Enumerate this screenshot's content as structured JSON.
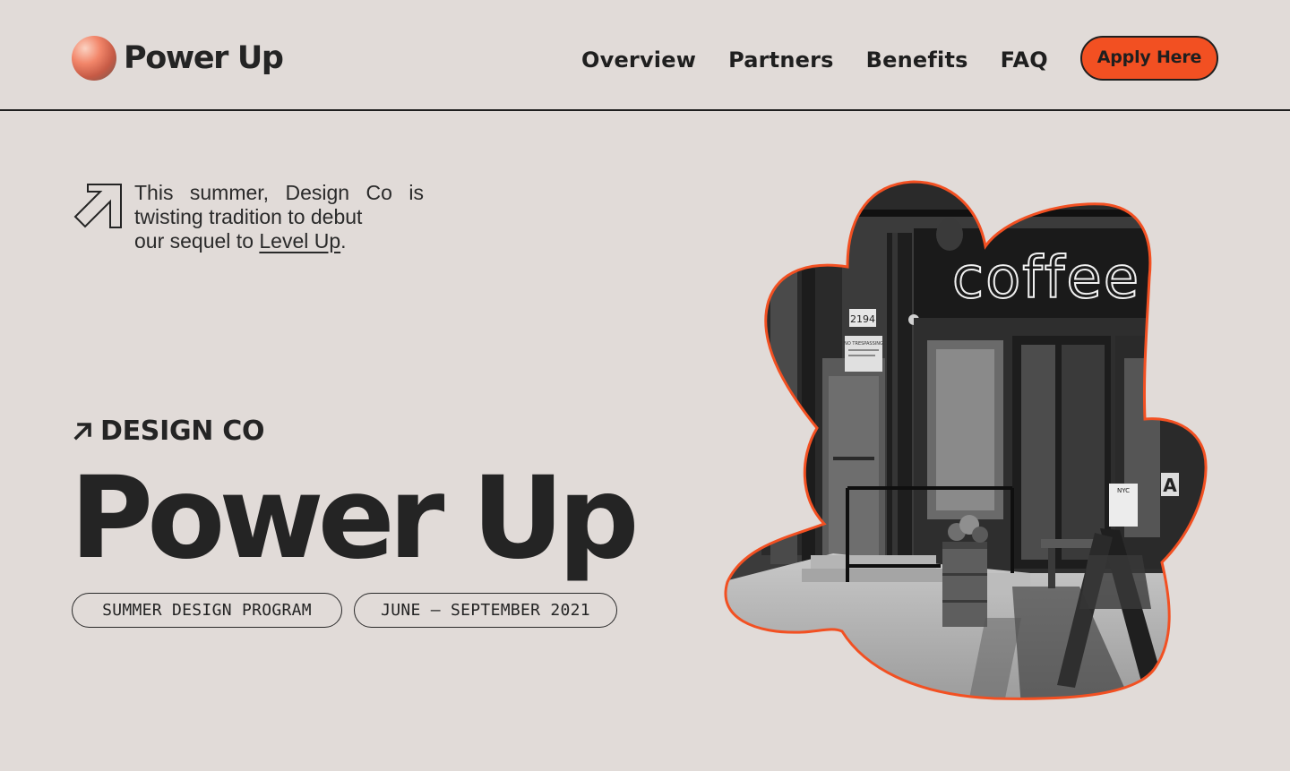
{
  "brand": {
    "name": "Power Up"
  },
  "nav": {
    "links": [
      "Overview",
      "Partners",
      "Benefits",
      "FAQ"
    ],
    "cta": "Apply Here"
  },
  "intro": {
    "text_before": "This summer, Design Co is twisting tradition to debut",
    "text_line3": "our sequel to ",
    "link": "Level Up",
    "text_after": "."
  },
  "hero": {
    "eyebrow": "DESIGN CO",
    "title": "Power Up",
    "tags": [
      "SUMMER DESIGN PROGRAM",
      "JUNE – SEPTEMBER 2021"
    ]
  },
  "photo": {
    "sign_text": "coffee",
    "address_number": "2194",
    "notice_text": "NO TRESPASSING",
    "window_letter": "A",
    "window_sticker": "NYC"
  },
  "colors": {
    "background": "#e1dbd8",
    "accent": "#f25022",
    "ink": "#242424"
  }
}
